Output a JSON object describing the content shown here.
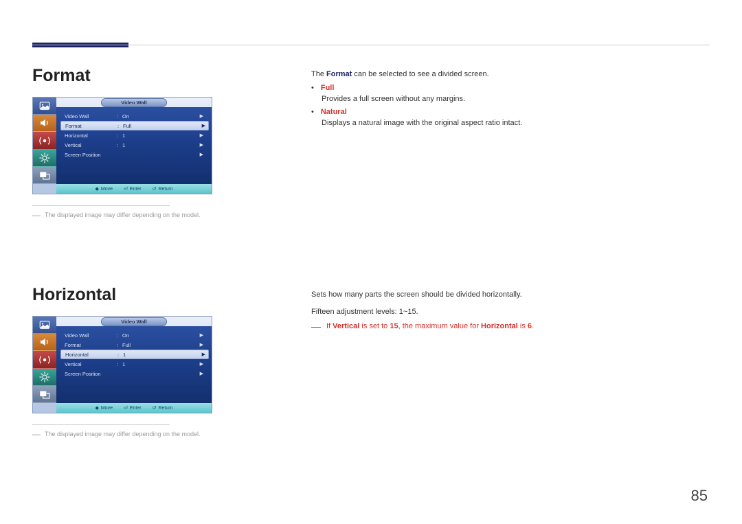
{
  "page_number": "85",
  "sections": {
    "format": {
      "title": "Format",
      "intro_pre": "The ",
      "intro_bold": "Format",
      "intro_post": " can be selected to see a divided screen.",
      "items": {
        "full": {
          "label": "Full",
          "desc": "Provides a full screen without any margins."
        },
        "natural": {
          "label": "Natural",
          "desc": "Displays a natural image with the original aspect ratio intact."
        }
      }
    },
    "horizontal": {
      "title": "Horizontal",
      "line1": "Sets how many parts the screen should be divided horizontally.",
      "line2": "Fifteen adjustment levels: 1~15.",
      "note": {
        "pre": "If ",
        "b1": "Vertical",
        "mid1": " is set to ",
        "b2": "15",
        "mid2": ", the maximum value for ",
        "b3": "Horizontal",
        "mid3": " is ",
        "b4": "6",
        "post": "."
      }
    }
  },
  "footnote": "The displayed image may differ depending on the model.",
  "osd": {
    "title": "Video Wall",
    "rows": {
      "video_wall": {
        "label": "Video Wall",
        "value": "On"
      },
      "format": {
        "label": "Format",
        "value": "Full"
      },
      "horizontal": {
        "label": "Horizontal",
        "value": "1"
      },
      "vertical": {
        "label": "Vertical",
        "value": "1"
      },
      "screen_position": {
        "label": "Screen Position",
        "value": ""
      }
    },
    "footer": {
      "move": "Move",
      "enter": "Enter",
      "return": "Return"
    }
  }
}
